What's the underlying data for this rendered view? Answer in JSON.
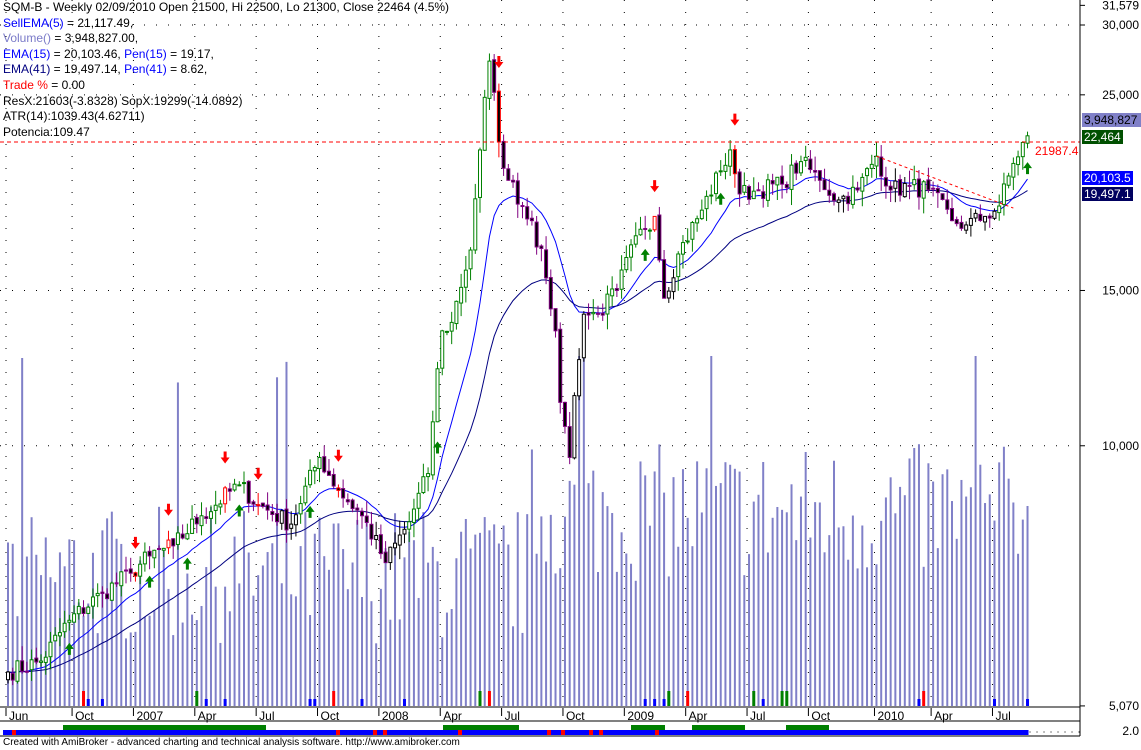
{
  "legend": {
    "title": "SQM-B - Weekly 02/09/2010 Open 21500, Hi 22500, Lo 21300, Close 22464 (4.5%)",
    "sell_ema_label": "SellEMA(5)",
    "sell_ema_value": " = 21,117.49,",
    "volume_label": "Volume()",
    "volume_value": " = 3,948,827.00,",
    "ema15_label": "EMA(15)",
    "ema15_value": " = 20,103.46, ",
    "pen15_label": "Pen(15)",
    "pen15_value": " = 19.17,",
    "ema41_label": "EMA(41)",
    "ema41_value": " = 19,497.14, ",
    "pen41_label": "Pen(41)",
    "pen41_value": " = 8.62,",
    "trade_label": "Trade %",
    "trade_value": " = 0.00",
    "resx": "ResX:21603(-3.8328) SopX:19299(-14.0892)",
    "atr": "ATR(14):1039.43(4.62711)",
    "potencia": "Potencia:109.47"
  },
  "tags": {
    "volume": "3,948,827",
    "close": "22,464",
    "resistance": "21987.4",
    "ema15": "20,103.5",
    "ema41": "19,497.1"
  },
  "colors": {
    "volume": "#8080c8",
    "close_tag": "#005000",
    "ema15": "#0000ff",
    "ema41": "#000080",
    "up": "#008000",
    "down": "#800080",
    "sell": "#ff0000"
  },
  "footer": "Created with AmiBroker - advanced charting and technical analysis software. http://www.amibroker.com",
  "chart_data": {
    "type": "candlestick",
    "title": "SQM-B - Weekly",
    "y_scale": "log",
    "ylim": [
      5070,
      31579
    ],
    "y_ticks": [
      "31,579",
      "30,000",
      "25,000",
      "15,000",
      "10,000",
      "5,070"
    ],
    "y_tick_values": [
      31579,
      30000,
      25000,
      15000,
      10000,
      5070
    ],
    "lower_pane_tick": "2.0",
    "x_ticks": [
      "Jun",
      "Oct",
      "2007",
      "Apr",
      "Jul",
      "Oct",
      "2008",
      "Apr",
      "Jul",
      "Oct",
      "2009",
      "Apr",
      "Jul",
      "Oct",
      "2010",
      "Apr",
      "Jul"
    ],
    "x_tick_weeks": [
      0,
      14,
      27,
      40,
      53,
      66,
      79,
      92,
      105,
      118,
      131,
      144,
      157,
      170,
      184,
      196,
      209
    ],
    "close_anchors_week_price": [
      [
        0,
        5540
      ],
      [
        7,
        5700
      ],
      [
        13,
        6340
      ],
      [
        20,
        6800
      ],
      [
        26,
        7170
      ],
      [
        30,
        7500
      ],
      [
        35,
        7700
      ],
      [
        41,
        8330
      ],
      [
        49,
        9030
      ],
      [
        53,
        8570
      ],
      [
        60,
        8150
      ],
      [
        66,
        9700
      ],
      [
        70,
        8900
      ],
      [
        75,
        8330
      ],
      [
        80,
        7370
      ],
      [
        85,
        8200
      ],
      [
        89,
        9300
      ],
      [
        92,
        13500
      ],
      [
        94,
        13800
      ],
      [
        98,
        16670
      ],
      [
        100,
        21650
      ],
      [
        102,
        27300
      ],
      [
        104,
        22100
      ],
      [
        106,
        20000
      ],
      [
        111,
        18000
      ],
      [
        114,
        15500
      ],
      [
        116,
        13500
      ],
      [
        117,
        11200
      ],
      [
        119,
        9700
      ],
      [
        120,
        11400
      ],
      [
        122,
        14100
      ],
      [
        125,
        14100
      ],
      [
        129,
        15000
      ],
      [
        134,
        17600
      ],
      [
        137,
        18200
      ],
      [
        139,
        14700
      ],
      [
        142,
        16500
      ],
      [
        147,
        18500
      ],
      [
        151,
        20500
      ],
      [
        153,
        21650
      ],
      [
        155,
        19300
      ],
      [
        159,
        19500
      ],
      [
        164,
        19800
      ],
      [
        168,
        21000
      ],
      [
        172,
        20000
      ],
      [
        176,
        19000
      ],
      [
        180,
        19500
      ],
      [
        184,
        21300
      ],
      [
        187,
        19500
      ],
      [
        191,
        19700
      ],
      [
        195,
        19500
      ],
      [
        200,
        18000
      ],
      [
        203,
        17800
      ],
      [
        207,
        18200
      ],
      [
        210,
        18700
      ],
      [
        213,
        20900
      ],
      [
        216,
        22464
      ]
    ],
    "volume_last": 3948827,
    "sell_signal_weeks": [
      27,
      34,
      46,
      53,
      70,
      104,
      137,
      154
    ],
    "buy_signal_weeks": [
      13,
      30,
      38,
      49,
      64,
      91,
      135,
      151,
      216
    ],
    "resistance_level": 21987.4,
    "ema_periods": [
      15,
      41
    ]
  }
}
